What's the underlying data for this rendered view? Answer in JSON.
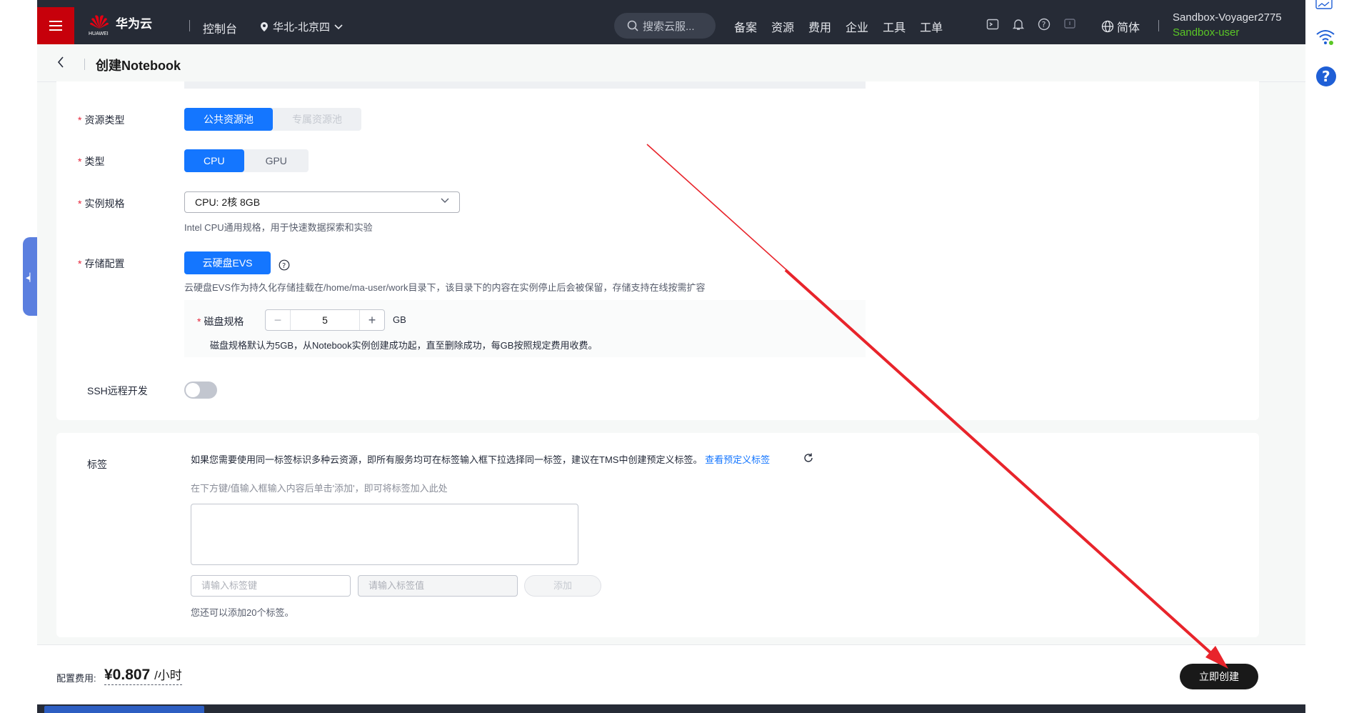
{
  "topnav": {
    "brand": "华为云",
    "brand_sub": "HUAWEI",
    "console": "控制台",
    "region": "华北-北京四",
    "search_placeholder": "搜索云服...",
    "links": [
      "备案",
      "资源",
      "费用",
      "企业",
      "工具",
      "工单"
    ],
    "lang": "简体",
    "username": "Sandbox-Voyager2775",
    "user_role": "Sandbox-user"
  },
  "page": {
    "title": "创建Notebook"
  },
  "form": {
    "resource_type_label": "资源类型",
    "resource_type_options": [
      "公共资源池",
      "专属资源池"
    ],
    "type_label": "类型",
    "type_options": [
      "CPU",
      "GPU"
    ],
    "spec_label": "实例规格",
    "spec_value": "CPU: 2核 8GB",
    "spec_hint": "Intel CPU通用规格，用于快速数据探索和实验",
    "storage_label": "存储配置",
    "storage_option": "云硬盘EVS",
    "storage_hint": "云硬盘EVS作为持久化存储挂载在/home/ma-user/work目录下，该目录下的内容在实例停止后会被保留，存储支持在线按需扩容",
    "disk_label": "磁盘规格",
    "disk_value": "5",
    "disk_unit": "GB",
    "disk_hint": "磁盘规格默认为5GB，从Notebook实例创建成功起，直至删除成功，每GB按照规定费用收费。",
    "ssh_label": "SSH远程开发",
    "ssh_enabled": false
  },
  "tags": {
    "label": "标签",
    "description": "如果您需要使用同一标签标识多种云资源，即所有服务均可在标签输入框下拉选择同一标签，建议在TMS中创建预定义标签。",
    "link": "查看预定义标签",
    "input_hint": "在下方键/值输入框输入内容后单击'添加'，即可将标签加入此处",
    "key_placeholder": "请输入标签键",
    "value_placeholder": "请输入标签值",
    "add_button": "添加",
    "remaining": "您还可以添加20个标签。"
  },
  "footer": {
    "fee_label": "配置费用:",
    "fee_value": "¥0.807",
    "fee_unit": "/小时",
    "create_button": "立即创建"
  },
  "colors": {
    "primary": "#1476ff",
    "nav_bg": "#262b36",
    "brand_red": "#c7000b",
    "annotation_arrow": "#e8242b"
  }
}
